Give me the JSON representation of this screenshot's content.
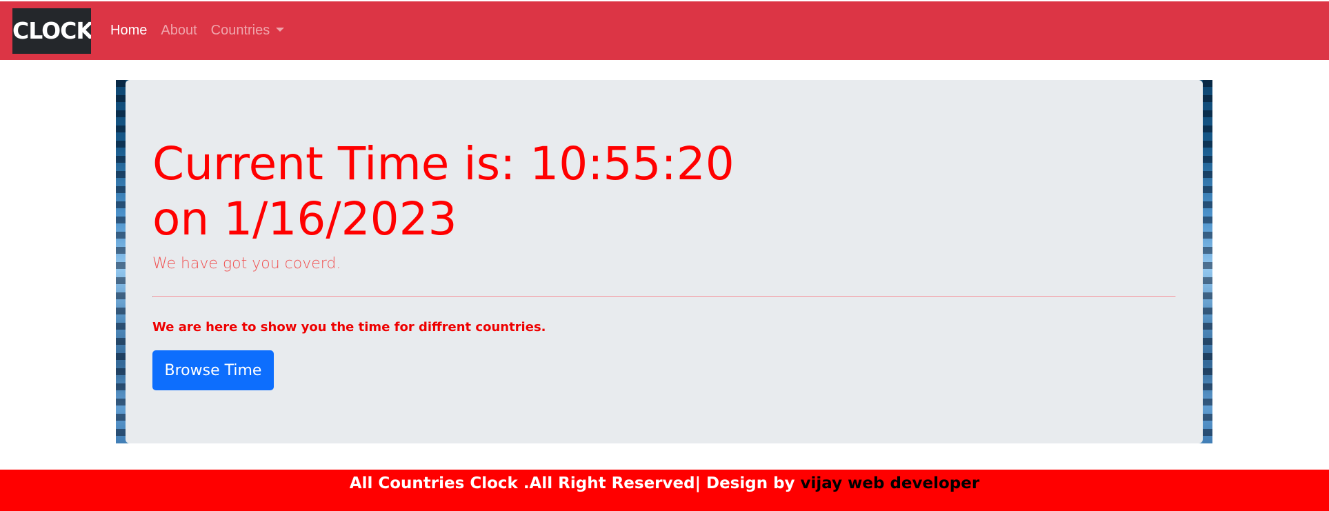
{
  "navbar": {
    "brand": "CLOCK",
    "links": [
      {
        "label": "Home",
        "active": true
      },
      {
        "label": "About",
        "active": false
      },
      {
        "label": "Countries",
        "active": false,
        "dropdown": true
      }
    ],
    "bg_color": "#dc3545"
  },
  "hero": {
    "title_line1": "Current Time is: 10:55:20",
    "title_line2": "on 1/16/2023",
    "lead": "We have got you coverd.",
    "paragraph": "We are here to show you the time for diffrent countries.",
    "button_label": "Browse Time",
    "accent_color": "#ff0000",
    "button_color": "#0d6efd"
  },
  "footer": {
    "text": "All Countries Clock .All Right Reserved| Design by ",
    "link_text": "vijay web developer",
    "bg_color": "#ff0000"
  }
}
